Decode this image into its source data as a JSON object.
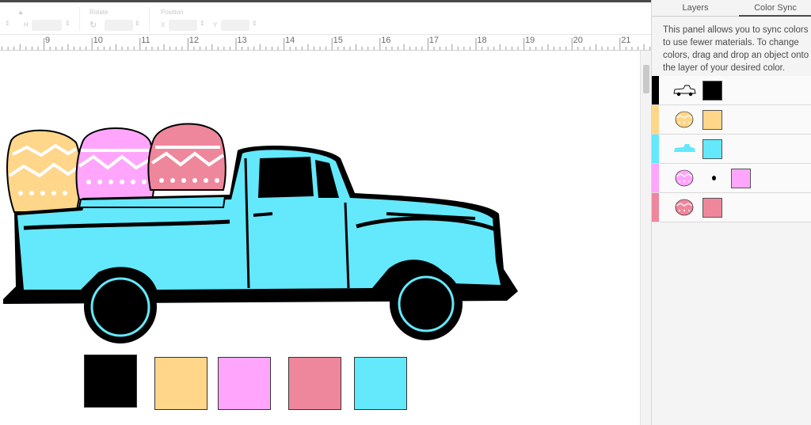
{
  "toolbar": {
    "size_label": "Size",
    "w_label": "W",
    "h_label": "H",
    "rotate_label": "Rotate",
    "position_label": "Position",
    "x_label": "X",
    "y_label": "Y"
  },
  "ruler": {
    "labels": [
      "9",
      "10",
      "11",
      "12",
      "13",
      "14",
      "15",
      "16",
      "17",
      "18",
      "19",
      "20",
      "21"
    ]
  },
  "panel": {
    "tabs": [
      {
        "label": "Layers",
        "active": false
      },
      {
        "label": "Color Sync",
        "active": true
      }
    ],
    "description": "This panel allows you to sync colors to use fewer materials. To change colors, drag and drop an object onto the layer of your desired color.",
    "rows": [
      {
        "color": "#000000",
        "thumb": "truck-outline-thumbnail"
      },
      {
        "color": "#ffd68a",
        "thumb": "yellow-egg-thumbnail"
      },
      {
        "color": "#64e8fb",
        "thumb": "blue-truck-thumbnail"
      },
      {
        "color": "#ffa6fc",
        "thumb": "pink-egg-thumbnail"
      },
      {
        "color": "#ef879c",
        "thumb": "red-egg-thumbnail"
      }
    ]
  },
  "canvas": {
    "swatches": [
      "#000000",
      "#ffd68a",
      "#ffa6fc",
      "#ef879c",
      "#64e8fb"
    ]
  },
  "colors": {
    "black": "#000000",
    "yellow": "#ffd68a",
    "cyan": "#64e8fb",
    "pink": "#ffa6fc",
    "rose": "#ef879c"
  }
}
